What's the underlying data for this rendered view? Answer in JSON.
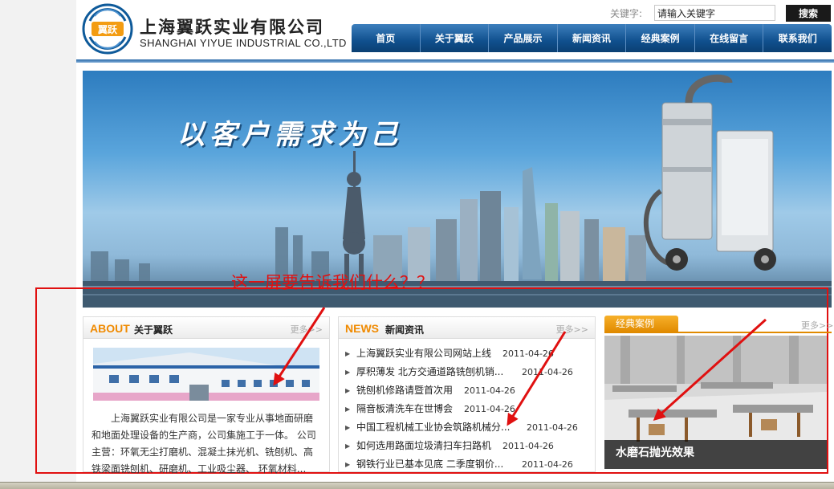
{
  "header": {
    "logo_badge": "翼跃",
    "company_cn": "上海翼跃实业有限公司",
    "company_en": "SHANGHAI YIYUE INDUSTRIAL CO.,LTD",
    "search_label": "关键字:",
    "search_value": "请输入关键字",
    "search_button": "搜索"
  },
  "nav": [
    "首页",
    "关于翼跃",
    "产品展示",
    "新闻资讯",
    "经典案例",
    "在线留言",
    "联系我们"
  ],
  "banner": {
    "slogan": "以客户需求为己"
  },
  "annotation": {
    "text": "这一屏要告诉我们什么？？",
    "color": "#e01010"
  },
  "about": {
    "title_en": "ABOUT",
    "title_cn": "关于翼跃",
    "more": "更多>>",
    "text": "上海翼跃实业有限公司是一家专业从事地面研磨和地面处理设备的生产商，公司集施工于一体。 公司主营：环氧无尘打磨机、混凝土抹光机、铣刨机、高铁梁面铣刨机、研磨机、工业吸尘器、 环氧材料..."
  },
  "news": {
    "title_en": "NEWS",
    "title_cn": "新闻资讯",
    "more": "更多>>",
    "items": [
      {
        "title": "上海翼跃实业有限公司网站上线",
        "date": "2011-04-26"
      },
      {
        "title": "厚积薄发 北方交通道路铣刨机销...",
        "date": "2011-04-26"
      },
      {
        "title": "铣刨机修路请暨首次用",
        "date": "2011-04-26"
      },
      {
        "title": "隔音板清洗车在世博会",
        "date": "2011-04-26"
      },
      {
        "title": "中国工程机械工业协会筑路机械分...",
        "date": "2011-04-26"
      },
      {
        "title": "如何选用路面垃圾清扫车扫路机",
        "date": "2011-04-26"
      },
      {
        "title": "钢铁行业已基本见底 二季度钢价...",
        "date": "2011-04-26"
      }
    ]
  },
  "cases": {
    "tab_label": "经典案例",
    "more": "更多>>",
    "caption": "水磨石抛光效果"
  },
  "colors": {
    "nav_blue": "#10508e",
    "accent_orange": "#f08a00",
    "annotation_red": "#e01010"
  }
}
